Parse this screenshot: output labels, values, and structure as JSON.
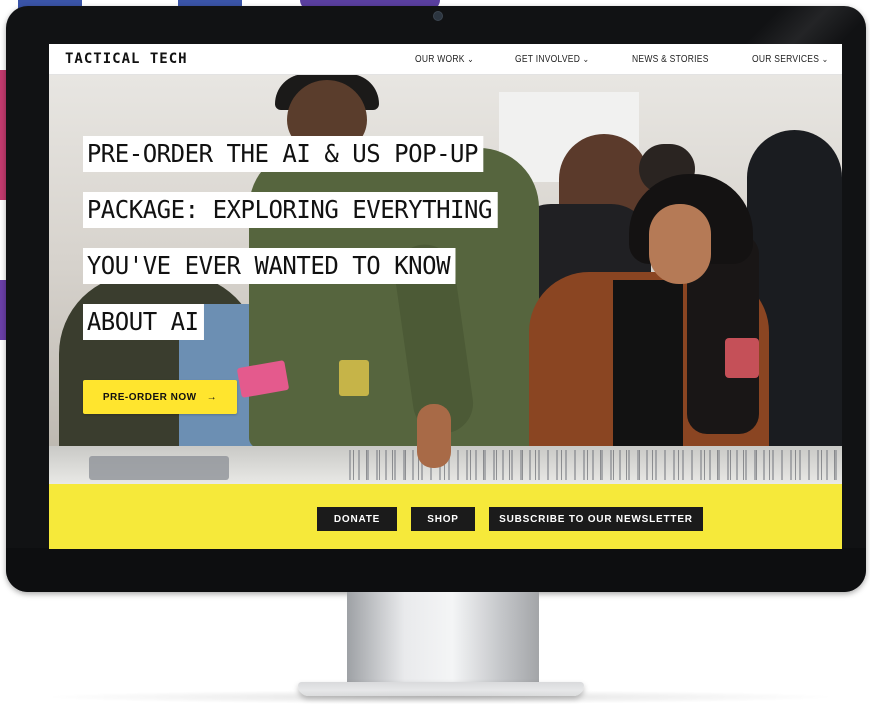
{
  "site": {
    "logo": "TACTICAL TECH",
    "nav": [
      {
        "label": "OUR WORK",
        "has_dropdown": true
      },
      {
        "label": "GET INVOLVED",
        "has_dropdown": true
      },
      {
        "label": "NEWS & STORIES",
        "has_dropdown": false
      },
      {
        "label": "OUR SERVICES",
        "has_dropdown": true
      }
    ]
  },
  "hero": {
    "headline_lines": [
      "PRE-ORDER THE AI & US POP-UP",
      "PACKAGE: EXPLORING EVERYTHING",
      "YOU'VE EVER WANTED TO KNOW",
      "ABOUT AI"
    ],
    "cta_label": "PRE-ORDER NOW",
    "cta_arrow": "→"
  },
  "action_bar": {
    "donate": "DONATE",
    "shop": "SHOP",
    "subscribe": "SUBSCRIBE TO OUR NEWSLETTER"
  },
  "icons": {
    "chevron": "⌄"
  },
  "colors": {
    "accent_yellow": "#f6e93a",
    "cta_yellow": "#ffe52e",
    "dark_button": "#1b1b1b",
    "monitor_bezel": "#111214"
  }
}
